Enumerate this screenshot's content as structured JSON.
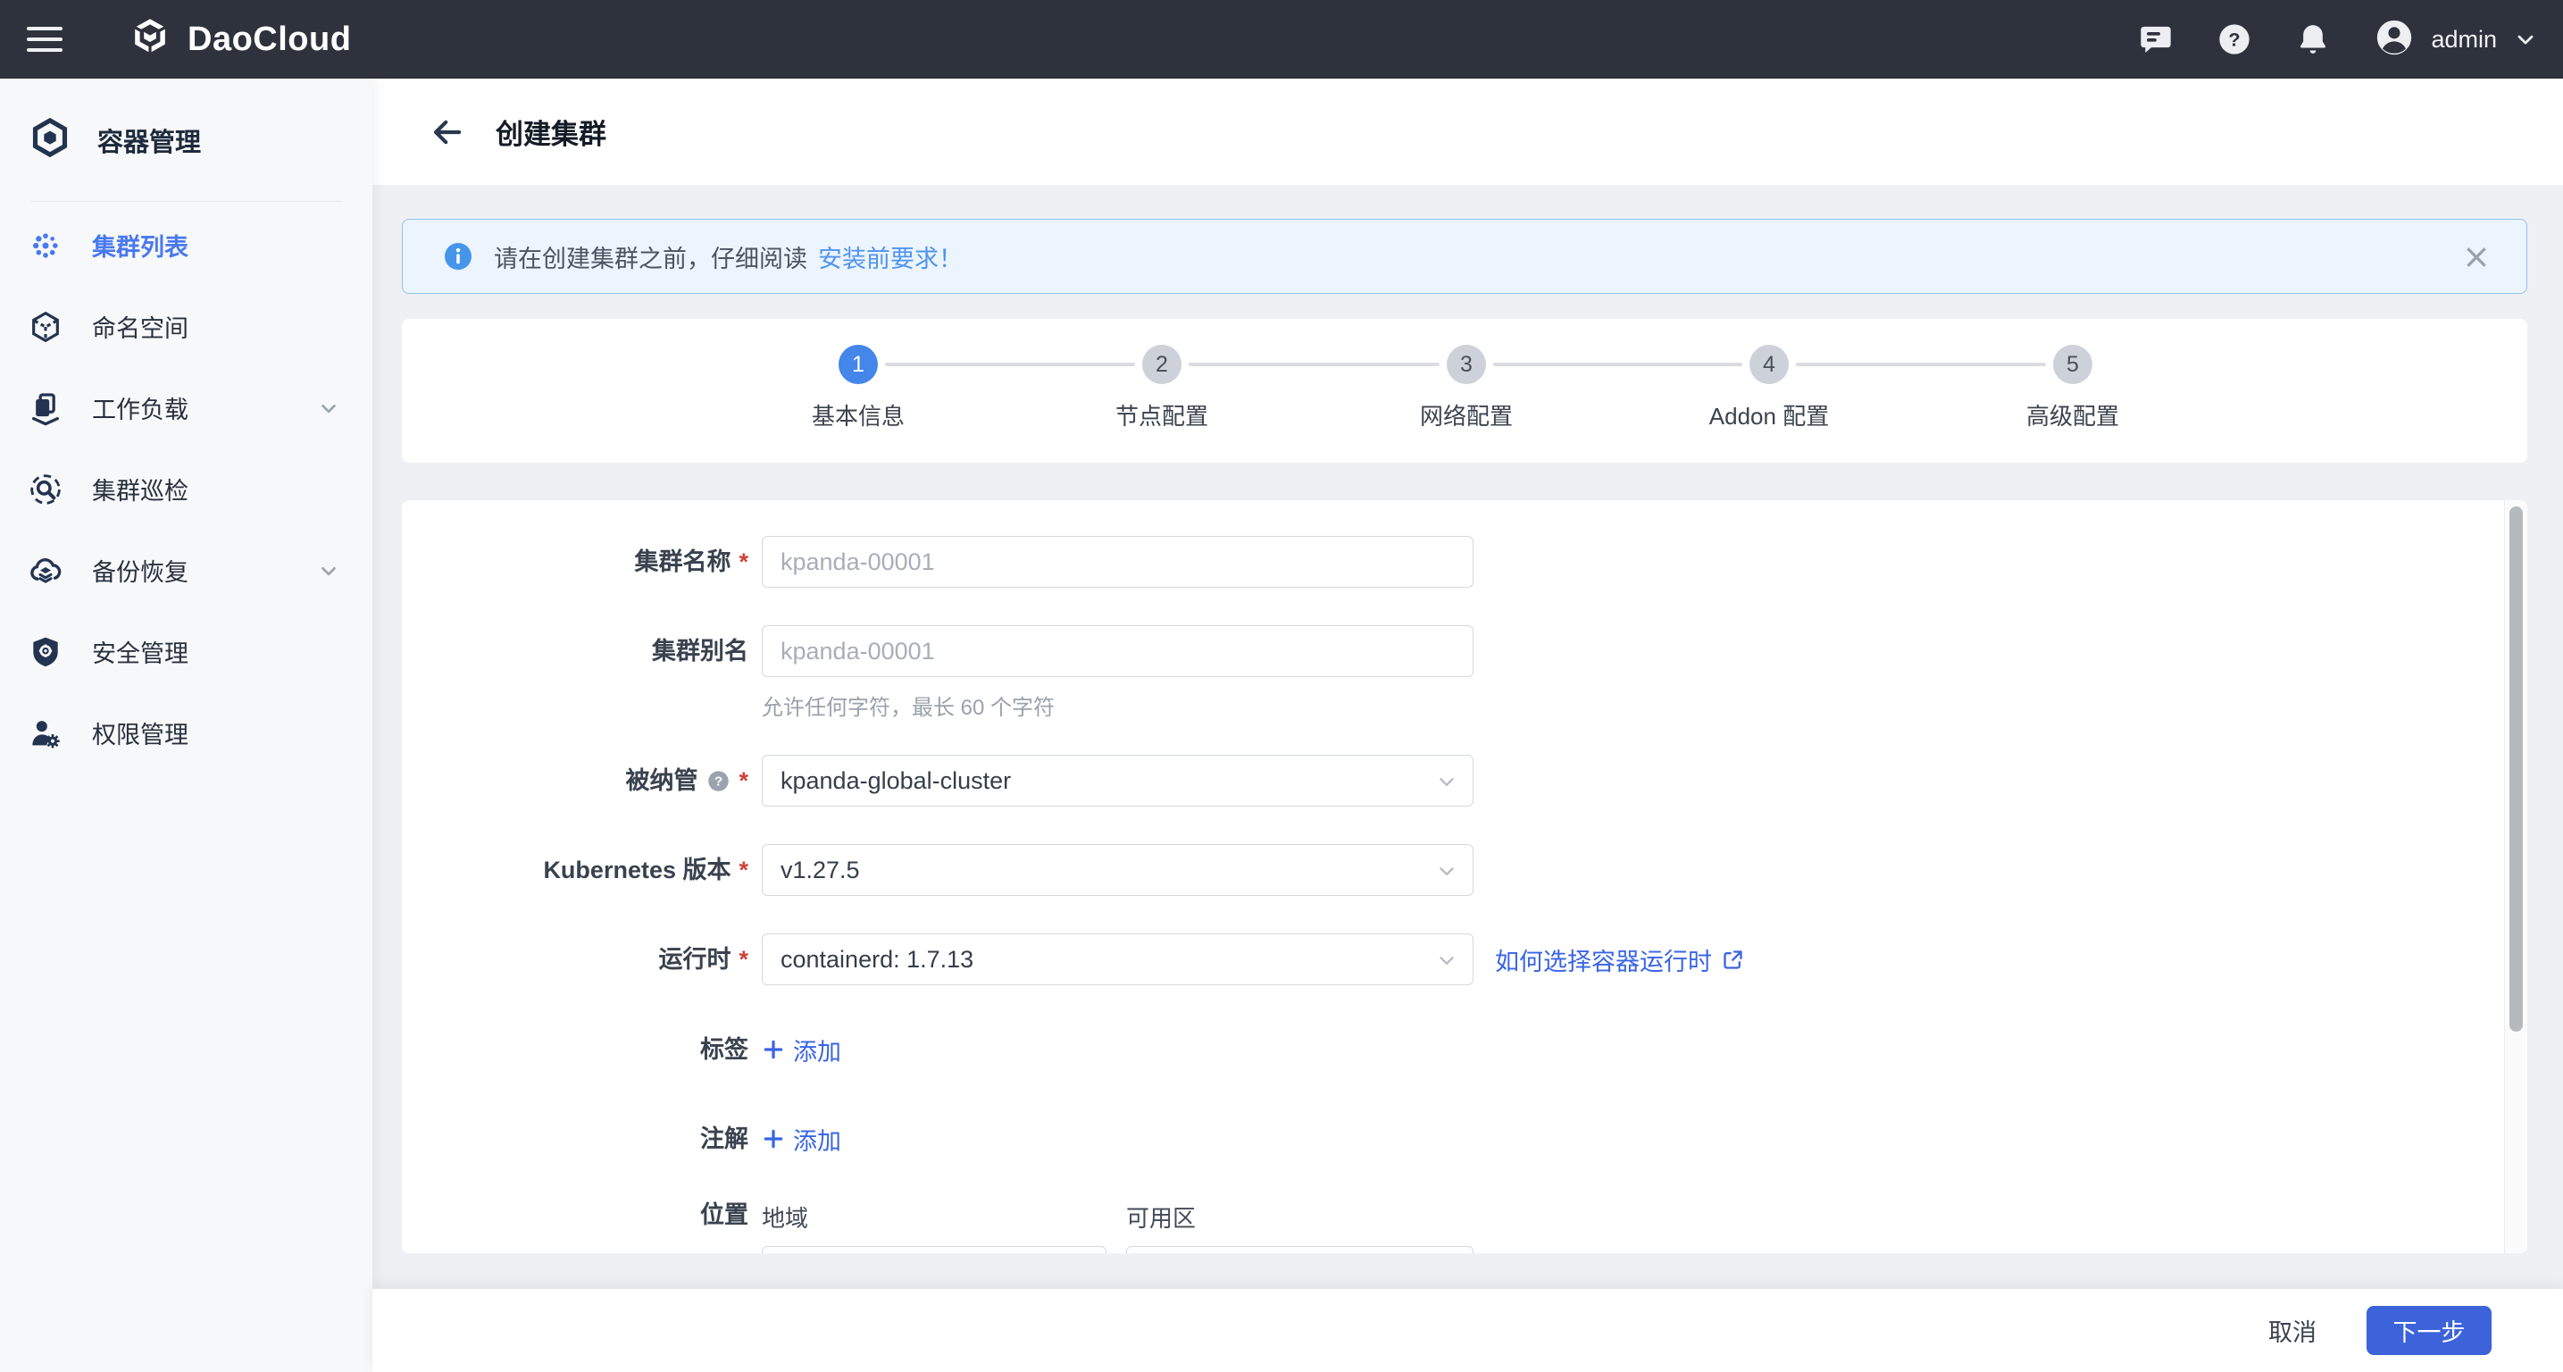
{
  "topbar": {
    "brand": "DaoCloud",
    "user": "admin"
  },
  "sidebar": {
    "title": "容器管理",
    "items": [
      {
        "label": "集群列表"
      },
      {
        "label": "命名空间"
      },
      {
        "label": "工作负载"
      },
      {
        "label": "集群巡检"
      },
      {
        "label": "备份恢复"
      },
      {
        "label": "安全管理"
      },
      {
        "label": "权限管理"
      }
    ]
  },
  "header": {
    "title": "创建集群"
  },
  "alert": {
    "text": "请在创建集群之前，仔细阅读",
    "link": "安装前要求！",
    "close": "×"
  },
  "stepper": [
    {
      "num": "1",
      "label": "基本信息"
    },
    {
      "num": "2",
      "label": "节点配置"
    },
    {
      "num": "3",
      "label": "网络配置"
    },
    {
      "num": "4",
      "label": "Addon 配置"
    },
    {
      "num": "5",
      "label": "高级配置"
    }
  ],
  "form": {
    "required_mark": "*",
    "cluster_name": {
      "label": "集群名称",
      "placeholder": "kpanda-00001"
    },
    "cluster_alias": {
      "label": "集群别名",
      "placeholder": "kpanda-00001",
      "hint": "允许任何字符，最长 60 个字符"
    },
    "managed_by": {
      "label": "被纳管",
      "value": "kpanda-global-cluster"
    },
    "k8s_version": {
      "label": "Kubernetes 版本",
      "value": "v1.27.5"
    },
    "runtime": {
      "label": "运行时",
      "value": "containerd: 1.7.13",
      "link": "如何选择容器运行时"
    },
    "labels": {
      "label": "标签",
      "add": "添加"
    },
    "annotations": {
      "label": "注解",
      "add": "添加"
    },
    "location": {
      "label": "位置",
      "region": "地域",
      "zone": "可用区"
    }
  },
  "footer": {
    "cancel": "取消",
    "next": "下一步"
  },
  "colors": {
    "topbar_bg": "#2d323d",
    "page_bg": "#eef0f4",
    "accent_blue": "#4a79ee",
    "button_blue": "#3d63da",
    "alert_bg": "#ecf4fd",
    "alert_border": "#94c3f0",
    "required_red": "#cf3f38"
  }
}
